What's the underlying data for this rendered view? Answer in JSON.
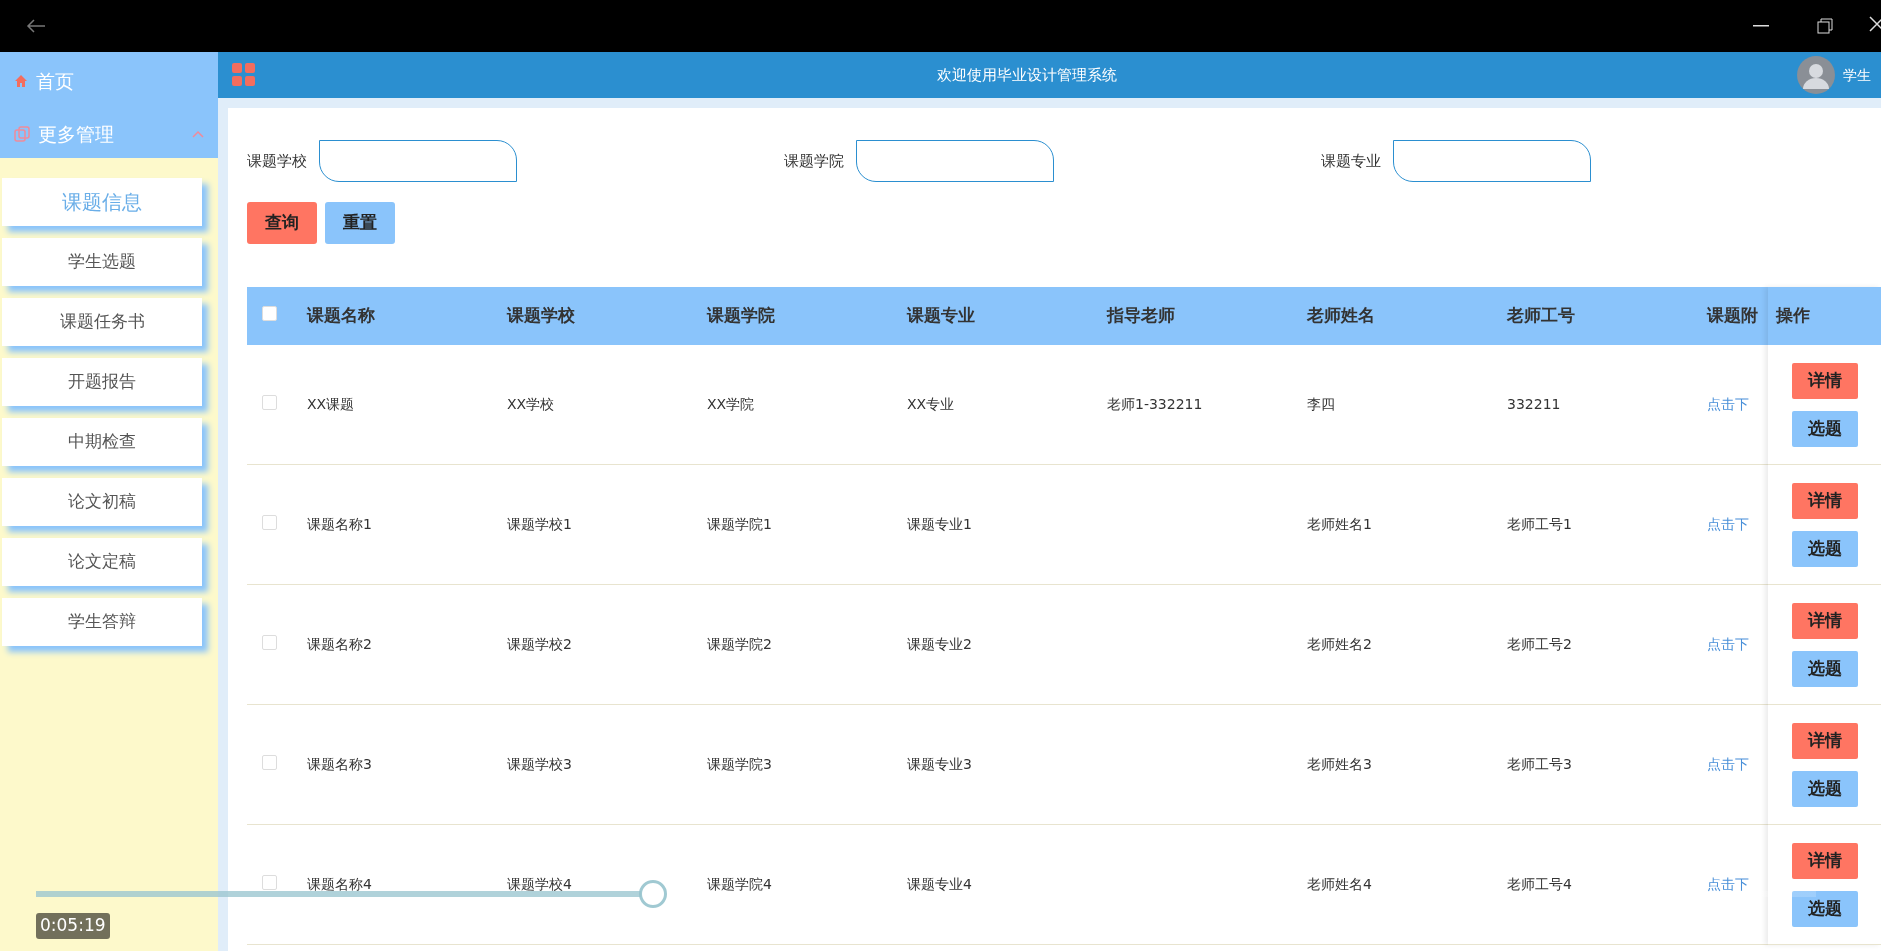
{
  "header": {
    "title": "欢迎使用毕业设计管理系统",
    "user": "学生"
  },
  "sidebar": {
    "home": "首页",
    "group": {
      "label": "更多管理",
      "expanded": true
    },
    "items": [
      {
        "label": "课题信息",
        "selected": true
      },
      {
        "label": "学生选题",
        "selected": false
      },
      {
        "label": "课题任务书",
        "selected": false
      },
      {
        "label": "开题报告",
        "selected": false
      },
      {
        "label": "中期检查",
        "selected": false
      },
      {
        "label": "论文初稿",
        "selected": false
      },
      {
        "label": "论文定稿",
        "selected": false
      },
      {
        "label": "学生答辩",
        "selected": false
      }
    ]
  },
  "search": {
    "fields": [
      {
        "label": "课题学校"
      },
      {
        "label": "课题学院"
      },
      {
        "label": "课题专业"
      }
    ],
    "buttons": [
      {
        "label": "查询",
        "kind": "primary"
      },
      {
        "label": "重置",
        "kind": "secondary"
      }
    ]
  },
  "table": {
    "select_all": {
      "checked": false
    },
    "columns": [
      "课题名称",
      "课题学校",
      "课题学院",
      "课题专业",
      "指导老师",
      "老师姓名",
      "老师工号",
      "课题附"
    ],
    "action_column": "操作",
    "rows": [
      {
        "checked": false,
        "cells": [
          "XX课题",
          "XX学校",
          "XX学院",
          "XX专业",
          "老师1-332211",
          "李四",
          "332211"
        ],
        "link": "点击下",
        "actions": [
          "详情",
          "选题"
        ]
      },
      {
        "checked": false,
        "cells": [
          "课题名称1",
          "课题学校1",
          "课题学院1",
          "课题专业1",
          null,
          "老师姓名1",
          "老师工号1"
        ],
        "link": "点击下",
        "actions": [
          "详情",
          "选题"
        ]
      },
      {
        "checked": false,
        "cells": [
          "课题名称2",
          "课题学校2",
          "课题学院2",
          "课题专业2",
          null,
          "老师姓名2",
          "老师工号2"
        ],
        "link": "点击下",
        "actions": [
          "详情",
          "选题"
        ]
      },
      {
        "checked": false,
        "cells": [
          "课题名称3",
          "课题学校3",
          "课题学院3",
          "课题专业3",
          null,
          "老师姓名3",
          "老师工号3"
        ],
        "link": "点击下",
        "actions": [
          "详情",
          "选题"
        ]
      },
      {
        "checked": false,
        "cells": [
          "课题名称4",
          "课题学校4",
          "课题学院4",
          "课题专业4",
          null,
          "老师姓名4",
          "老师工号4"
        ],
        "link": "点击下",
        "actions": [
          "详情",
          "选题"
        ]
      }
    ]
  },
  "player": {
    "level": 0.34,
    "time": "0:05:19"
  }
}
